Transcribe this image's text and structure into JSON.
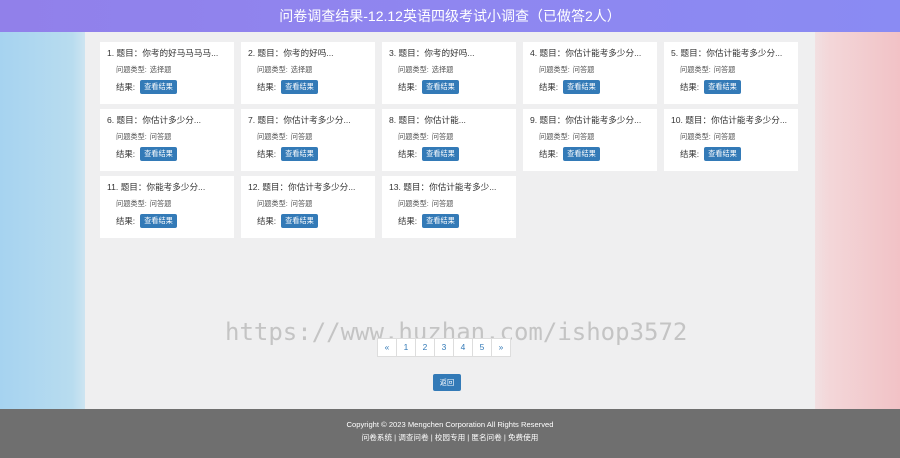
{
  "header": {
    "title": "问卷调查结果-12.12英语四级考试小调查（已做答2人）"
  },
  "labels": {
    "type_prefix": "问题类型:",
    "result_label": "结果:",
    "view_button": "查看结果"
  },
  "cards": [
    {
      "title": "1. 题目：你考的好马马马马...",
      "type": "选择题"
    },
    {
      "title": "2. 题目：你考的好吗...",
      "type": "选择题"
    },
    {
      "title": "3. 题目：你考的好吗...",
      "type": "选择题"
    },
    {
      "title": "4. 题目：你估计能考多少分...",
      "type": "问答题"
    },
    {
      "title": "5. 题目：你估计能考多少分...",
      "type": "问答题"
    },
    {
      "title": "6. 题目：你估计多少分...",
      "type": "问答题"
    },
    {
      "title": "7. 题目：你估计考多少分...",
      "type": "问答题"
    },
    {
      "title": "8. 题目：你估计能...",
      "type": "问答题"
    },
    {
      "title": "9. 题目：你估计能考多少分...",
      "type": "问答题"
    },
    {
      "title": "10. 题目：你估计能考多少分...",
      "type": "问答题"
    },
    {
      "title": "11. 题目：你能考多少分...",
      "type": "问答题"
    },
    {
      "title": "12. 题目：你估计考多少分...",
      "type": "问答题"
    },
    {
      "title": "13. 题目：你估计能考多少...",
      "type": "问答题"
    }
  ],
  "watermark": "https://www.huzhan.com/ishop3572",
  "pagination": {
    "prev": "«",
    "pages": [
      "1",
      "2",
      "3",
      "4",
      "5"
    ],
    "next": "»"
  },
  "back_button": "返回",
  "footer": {
    "copyright": "Copyright © 2023 Mengchen Corporation All Rights Reserved",
    "links": "问卷系统 | 调查问卷 | 校园专用 | 匿名问卷 | 免费使用"
  }
}
